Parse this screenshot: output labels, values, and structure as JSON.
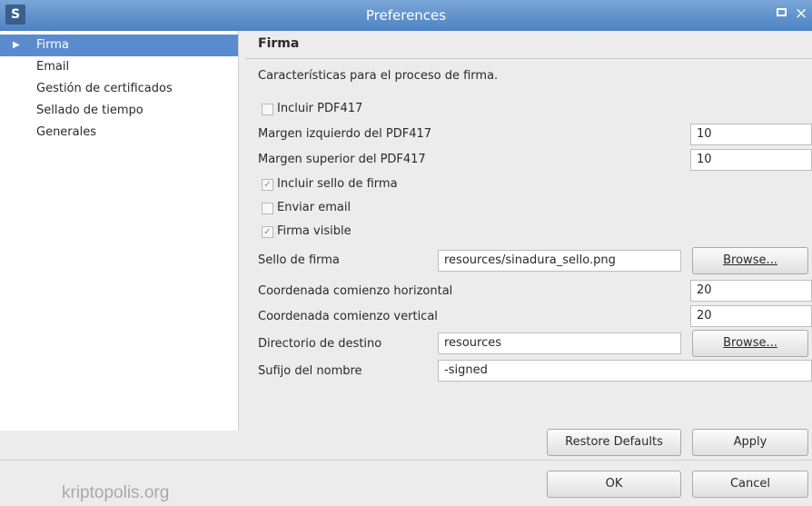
{
  "window": {
    "title": "Preferences",
    "app_icon": "S"
  },
  "sidebar": {
    "items": [
      {
        "label": "Firma",
        "selected": true
      },
      {
        "label": "Email",
        "selected": false
      },
      {
        "label": "Gestión de certificados",
        "selected": false
      },
      {
        "label": "Sellado de tiempo",
        "selected": false
      },
      {
        "label": "Generales",
        "selected": false
      }
    ]
  },
  "page": {
    "title": "Firma",
    "description": "Características para el proceso de firma.",
    "incluir_pdf417": {
      "label": "Incluir PDF417",
      "checked": false
    },
    "margen_izquierdo": {
      "label": "Margen izquierdo del PDF417",
      "value": "10"
    },
    "margen_superior": {
      "label": "Margen superior del PDF417",
      "value": "10"
    },
    "incluir_sello": {
      "label": "Incluir sello de firma",
      "checked": true
    },
    "enviar_email": {
      "label": "Enviar email",
      "checked": false
    },
    "firma_visible": {
      "label": "Firma visible",
      "checked": true
    },
    "sello_de_firma": {
      "label": "Sello de firma",
      "value": "resources/sinadura_sello.png",
      "browse": "Browse..."
    },
    "coord_horizontal": {
      "label": "Coordenada comienzo horizontal",
      "value": "20"
    },
    "coord_vertical": {
      "label": "Coordenada comienzo vertical",
      "value": "20"
    },
    "directorio_destino": {
      "label": "Directorio de destino",
      "value": "resources",
      "browse": "Browse..."
    },
    "sufijo_nombre": {
      "label": "Sufijo del nombre",
      "value": "-signed"
    },
    "restore_defaults": "Restore Defaults",
    "apply": "Apply"
  },
  "footer": {
    "ok": "OK",
    "cancel": "Cancel",
    "watermark": "kriptopolis.org"
  },
  "colors": {
    "titlebar": "#4d82c2",
    "selection": "#5a8bcf"
  },
  "icons": {
    "expand": "triangle-right-icon",
    "check": "check-icon",
    "close": "close-icon",
    "maximize": "maximize-icon"
  }
}
